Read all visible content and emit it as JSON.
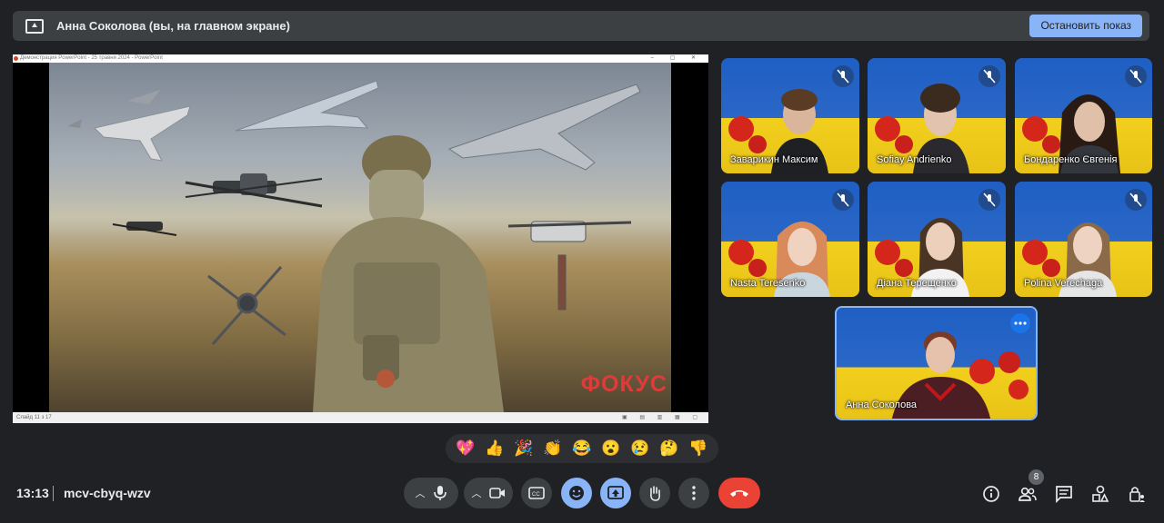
{
  "banner": {
    "title": "Анна Соколова (вы, на главном экране)",
    "stop_label": "Остановить показ"
  },
  "shared_screen": {
    "window_title": "Демонстрация PowerPoint - 25 травня 2024 - PowerPoint",
    "slide_status": "Слайд 11 з 17",
    "slide_caption": "ФОКУС"
  },
  "participants": [
    {
      "name": "Заварикин Максим",
      "muted": true
    },
    {
      "name": "Sofiay Andrienko",
      "muted": true
    },
    {
      "name": "Бондаренко Євгенія",
      "muted": true
    },
    {
      "name": "Nasta Teresenko",
      "muted": true
    },
    {
      "name": "Діана Терещенко",
      "muted": true
    },
    {
      "name": "Polina Verechaga",
      "muted": true
    }
  ],
  "presenter": {
    "name": "Анна Соколова"
  },
  "reactions": [
    "💖",
    "👍",
    "🎉",
    "👏",
    "😂",
    "😮",
    "😢",
    "🤔",
    "👎"
  ],
  "footer": {
    "time": "13:13",
    "meeting_code": "mcv-cbyq-wzv",
    "participant_count": "8"
  },
  "colors": {
    "accent": "#8ab4f8",
    "end_call": "#ea4335",
    "bg": "#202124",
    "flag_blue": "#1f5fc4",
    "flag_yellow": "#f2cf1d"
  }
}
